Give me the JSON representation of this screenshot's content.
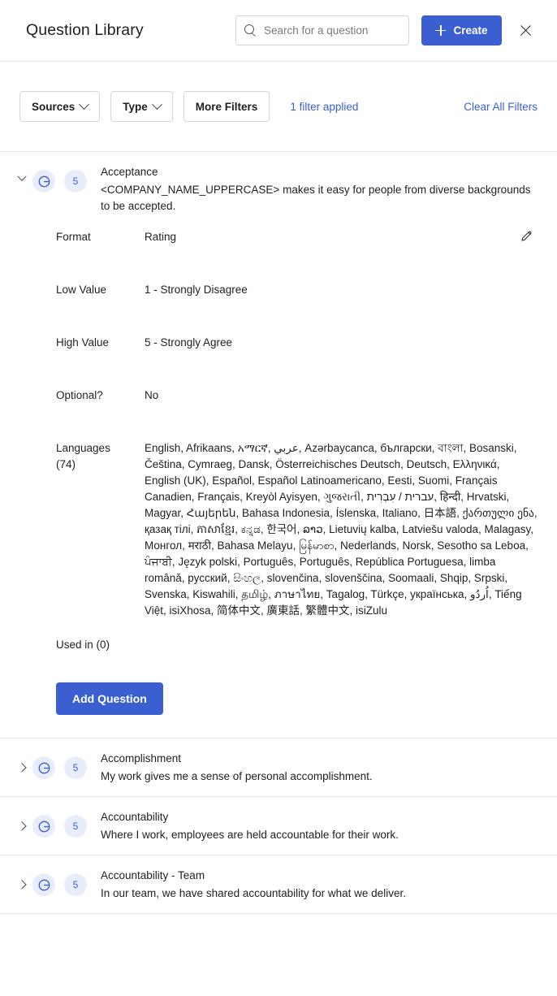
{
  "header": {
    "title": "Question Library",
    "search_placeholder": "Search for a question",
    "search_value": "",
    "create_label": "Create",
    "close_label": "Close"
  },
  "filters": {
    "sources_label": "Sources",
    "type_label": "Type",
    "more_filters_label": "More Filters",
    "applied_label": "1 filter applied",
    "clear_label": "Clear All Filters"
  },
  "colors": {
    "accent": "#3b5fd1",
    "badge_bg": "#e9edfb",
    "border": "#e8e8e8",
    "text": "#201f1e"
  },
  "expanded_question": {
    "source_badge": "G",
    "scale_badge": "5",
    "name": "Acceptance",
    "text": "<COMPANY_NAME_UPPERCASE> makes it easy for people from diverse backgrounds to be accepted.",
    "details": [
      {
        "label": "Format",
        "value": "Rating"
      },
      {
        "label": "Low Value",
        "value": "1 - Strongly Disagree"
      },
      {
        "label": "High Value",
        "value": "5 - Strongly Agree"
      },
      {
        "label": "Optional?",
        "value": "No"
      }
    ],
    "languages_label": "Languages (74)",
    "languages_count": 74,
    "languages_value": "English, Afrikaans, አማርኛ, عربي, Azərbaycanca, български, বাংলা, Bosanski, Čeština, Cymraeg, Dansk, Österreichisches Deutsch, Deutsch, Ελληνικά, English (UK), Español, Español Latinoamericano, Eesti, Suomi, Français Canadien, Français, Kreyòl Ayisyen, ગુજરાતી, עברית / עִבְרִית, हिन्दी, Hrvatski, Magyar, Հայերեն, Bahasa Indonesia, Íslenska, Italiano, 日本語, ქართული ენა, қазақ тілі, ភាសាខ្មែរ, ಕನ್ನಡ, 한국어, ລາວ, Lietuvių kalba, Latviešu valoda, Malagasy, Монгол, मराठी, Bahasa Melayu, မြန်မာစာ, Nederlands, Norsk, Sesotho sa Leboa, ਪੰਜਾਬੀ, Język polski, Português, Português, República Portuguesa, limba română, русский, සිංහල, slovenčina, slovenščina, Soomaali, Shqip, Srpski, Svenska, Kiswahili, தமிழ், ภาษาไทย, Tagalog, Türkçe, українська, اُردُو, Tiếng Việt, isiXhosa, 简体中文, 廣東話, 繁體中文, isiZulu",
    "used_in_label": "Used in (0)",
    "add_question_label": "Add Question",
    "edit_label": "Edit"
  },
  "collapsed_questions": [
    {
      "source_badge": "G",
      "scale_badge": "5",
      "name": "Accomplishment",
      "text": "My work gives me a sense of personal accomplishment."
    },
    {
      "source_badge": "G",
      "scale_badge": "5",
      "name": "Accountability",
      "text": "Where I work, employees are held accountable for their work."
    },
    {
      "source_badge": "G",
      "scale_badge": "5",
      "name": "Accountability - Team",
      "text": "In our team, we have shared accountability for what we deliver."
    }
  ]
}
